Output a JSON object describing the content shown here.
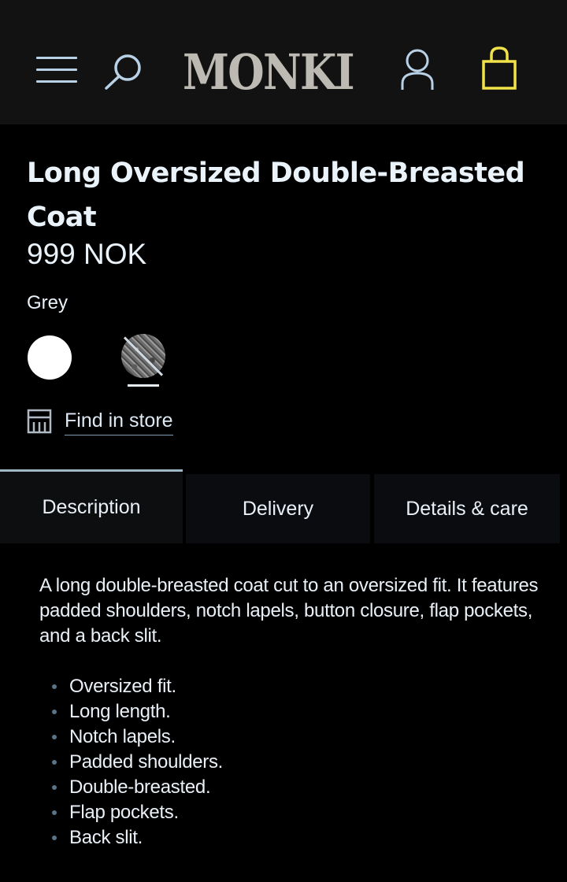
{
  "header": {
    "logo": "MONKI",
    "icons": {
      "menu": "hamburger-menu-icon",
      "search": "search-icon",
      "account": "user-icon",
      "bag": "shopping-bag-icon"
    },
    "colors": {
      "background": "#121212",
      "icon": "#b9d1e6",
      "bag_accent": "#f2e24a",
      "logo": "#bcbab3"
    }
  },
  "product": {
    "title": "Long Oversized Double-Breasted Coat",
    "price": "999 NOK",
    "selected_color": "Grey",
    "swatches": [
      {
        "name": "white",
        "color": "#ffffff"
      },
      {
        "name": "grey",
        "color": "#808080",
        "selected": true,
        "unavailable": true
      }
    ],
    "find_in_store": "Find in store"
  },
  "tabs": [
    {
      "label": "Description",
      "active": true
    },
    {
      "label": "Delivery",
      "active": false
    },
    {
      "label": "Details & care",
      "active": false
    }
  ],
  "description": {
    "text": "A long double-breasted coat cut to an oversized fit. It features padded shoulders, notch lapels, button closure, flap pockets, and a back slit.",
    "features": [
      "Oversized fit.",
      "Long length.",
      "Notch lapels.",
      "Padded shoulders.",
      "Double-breasted.",
      "Flap pockets.",
      "Back slit."
    ]
  }
}
